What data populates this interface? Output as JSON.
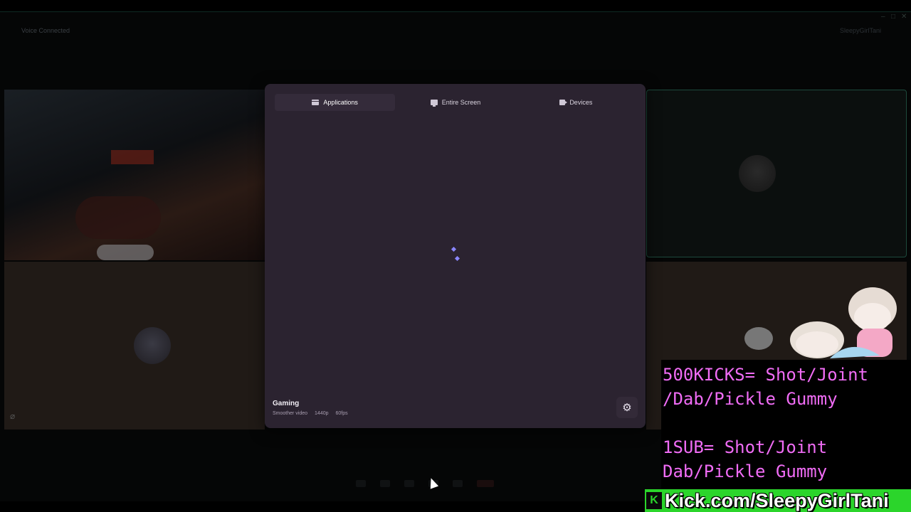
{
  "app": {
    "title": "Voice Connected",
    "top_right": "SleepyGirlTani"
  },
  "modal": {
    "tabs": [
      {
        "label": "Applications",
        "icon": "window-icon",
        "active": true
      },
      {
        "label": "Entire Screen",
        "icon": "monitor-icon",
        "active": false
      },
      {
        "label": "Devices",
        "icon": "camera-icon",
        "active": false
      }
    ],
    "loading": true,
    "quality": {
      "title": "Gaming",
      "mode": "Smoother video",
      "resolution": "1440p",
      "framerate": "60fps"
    },
    "settings_icon": "gear-icon"
  },
  "overlay": {
    "line1": "500KICKS= Shot/Joint",
    "line2": "/Dab/Pickle Gummy",
    "line3": "1SUB= Shot/Joint",
    "line4": "Dab/Pickle Gummy",
    "kick_url": "Kick.com/SleepyGirlTani",
    "kick_logo": "K",
    "text_color": "#f06cf5",
    "kick_color": "#2bd52b"
  },
  "colors": {
    "modal_bg": "#2b2330",
    "spinner": "#8a86ff",
    "accent_border": "#1d4a3c"
  }
}
